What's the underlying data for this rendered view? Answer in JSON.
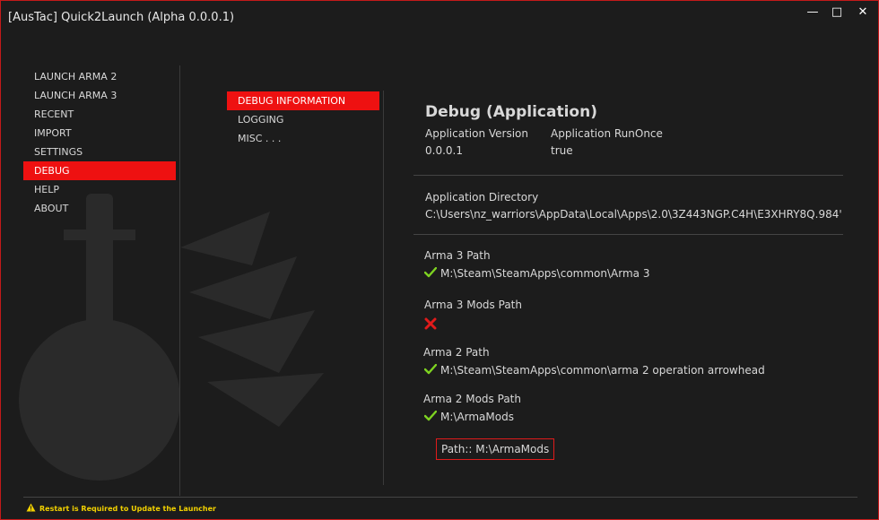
{
  "window": {
    "title": "[AusTac] Quick2Launch (Alpha 0.0.0.1)",
    "controls": {
      "minimize": "—",
      "maximize": "□",
      "close": "✕"
    }
  },
  "sidebar": {
    "items": [
      {
        "label": "LAUNCH ARMA 2",
        "active": false
      },
      {
        "label": "LAUNCH ARMA 3",
        "active": false
      },
      {
        "label": "RECENT",
        "active": false
      },
      {
        "label": "IMPORT",
        "active": false
      },
      {
        "label": "SETTINGS",
        "active": false
      },
      {
        "label": "DEBUG",
        "active": true
      },
      {
        "label": "HELP",
        "active": false
      },
      {
        "label": "ABOUT",
        "active": false
      }
    ]
  },
  "subnav": {
    "items": [
      {
        "label": "DEBUG INFORMATION",
        "active": true
      },
      {
        "label": "LOGGING",
        "active": false
      },
      {
        "label": "MISC . . .",
        "active": false
      }
    ]
  },
  "debug": {
    "heading": "Debug (Application)",
    "app_version_label": "Application Version",
    "app_version_value": "0.0.0.1",
    "run_once_label": "Application RunOnce",
    "run_once_value": "true",
    "app_dir_label": "Application Directory",
    "app_dir_value": "C:\\Users\\nz_warriors\\AppData\\Local\\Apps\\2.0\\3Z443NGP.C4H\\E3XHRY8Q.984'",
    "arma3_path_label": "Arma 3 Path",
    "arma3_path_value": "M:\\Steam\\SteamApps\\common\\Arma 3",
    "arma3_mods_label": "Arma 3 Mods Path",
    "arma2_path_label": "Arma 2 Path",
    "arma2_path_value": "M:\\Steam\\SteamApps\\common\\arma 2 operation arrowhead",
    "arma2_mods_label": "Arma 2 Mods Path",
    "arma2_mods_value": "M:\\ArmaMods",
    "path_box": "Path:: M:\\ArmaMods"
  },
  "status": {
    "arma3_path": "valid",
    "arma3_mods": "invalid",
    "arma2_path": "valid",
    "arma2_mods": "valid"
  },
  "footer": {
    "warning": "Restart is Required to Update the Launcher"
  },
  "colors": {
    "accent": "#ee1111",
    "check": "#7ed321",
    "cross": "#e01b1b",
    "warning": "#f1d000"
  }
}
